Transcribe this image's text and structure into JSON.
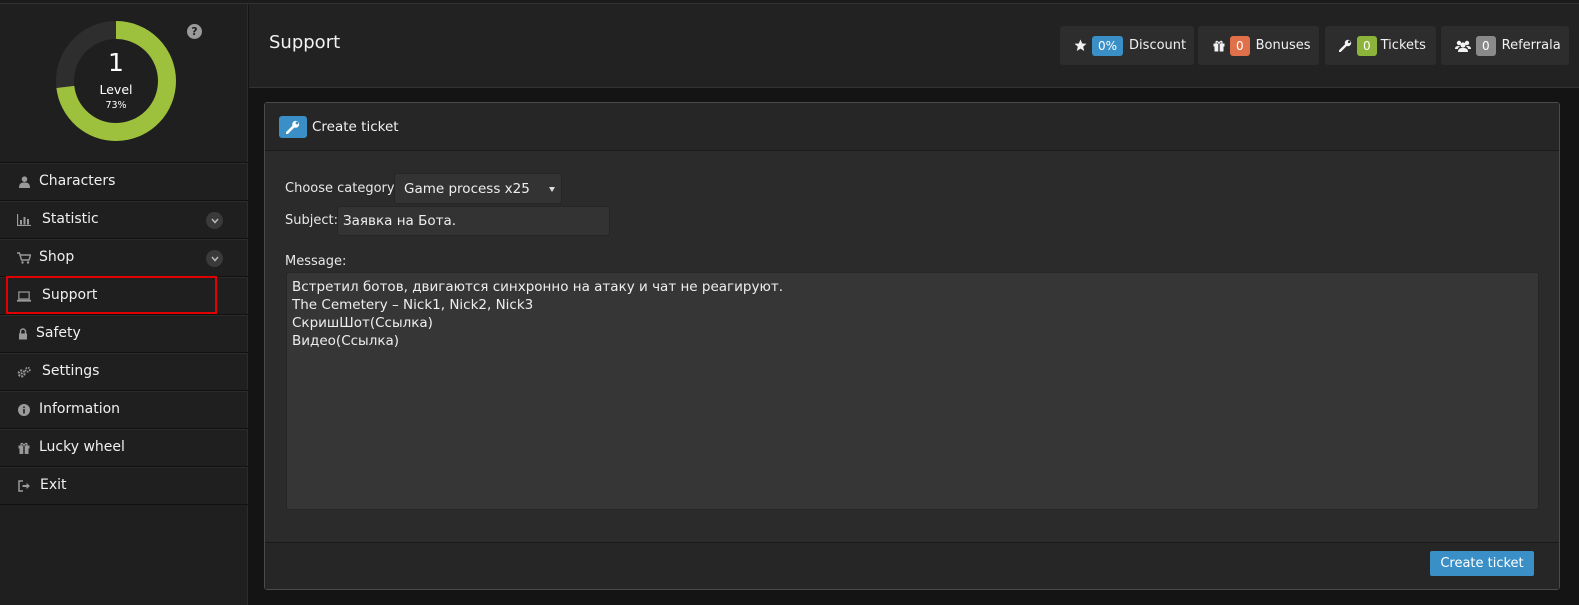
{
  "level": {
    "number": "1",
    "label": "Level",
    "percent_text": "73%",
    "progress": 0.73
  },
  "help": {
    "glyph": "?"
  },
  "sidebar": {
    "items": [
      {
        "label": "Characters",
        "icon": "user-icon"
      },
      {
        "label": "Statistic",
        "icon": "bar-chart-icon",
        "expandable": true
      },
      {
        "label": "Shop",
        "icon": "cart-icon",
        "expandable": true
      },
      {
        "label": "Support",
        "icon": "laptop-icon",
        "active": true
      },
      {
        "label": "Safety",
        "icon": "lock-icon"
      },
      {
        "label": "Settings",
        "icon": "gears-icon"
      },
      {
        "label": "Information",
        "icon": "info-icon"
      },
      {
        "label": "Lucky wheel",
        "icon": "gift-icon"
      },
      {
        "label": "Exit",
        "icon": "sign-out-icon"
      }
    ]
  },
  "header": {
    "title": "Support",
    "buttons": [
      {
        "badge": "0%",
        "label": "Discount",
        "icon": "star-icon",
        "badge_color": "#3a8fc7"
      },
      {
        "badge": "0",
        "label": "Bonuses",
        "icon": "gift-icon",
        "badge_color": "#e0704a"
      },
      {
        "badge": "0",
        "label": "Tickets",
        "icon": "wrench-icon",
        "badge_color": "#8cb33a"
      },
      {
        "badge": "0",
        "label": "Referrala",
        "icon": "users-icon",
        "badge_color": "#8a8a8a"
      }
    ]
  },
  "panel": {
    "title": "Create ticket",
    "category_label": "Choose category:",
    "category_value": "Game process x25",
    "subject_label": "Subject:",
    "subject_value": "Заявка на Бота.",
    "message_label": "Message:",
    "message_lines": [
      "Встретил ботов, двигаются синхронно на атаку и чат не реагируют.",
      "The Cemetery – Nick1, Nick2, Nick3",
      "СкришШот(Ссылка)",
      "Видео(Ссылка)"
    ],
    "submit_label": "Create ticket"
  },
  "colors": {
    "accent": "#3a8fc7",
    "level_ring": "#9dc13d",
    "highlight": "#e00000"
  }
}
